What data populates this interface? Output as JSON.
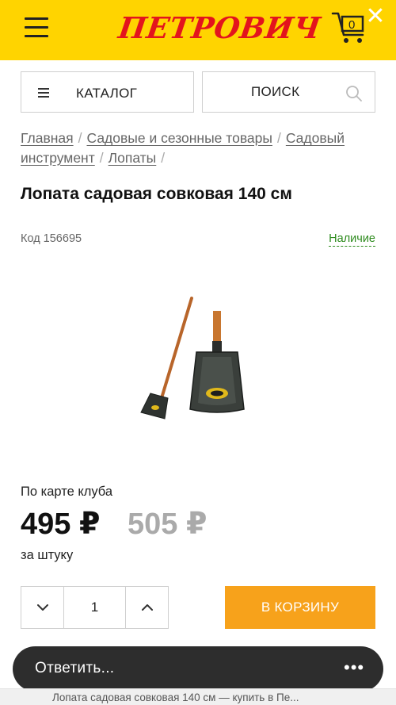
{
  "header": {
    "logo_text": "ПЕТРОВИЧ",
    "cart_count": "0",
    "brand_color": "#ffd400",
    "logo_color": "#e3141d"
  },
  "nav": {
    "catalog_label": "КАТАЛОГ",
    "search_label": "ПОИСК"
  },
  "breadcrumb": {
    "items": [
      "Главная",
      "Садовые и сезонные товары",
      "Садовый инструмент",
      "Лопаты"
    ],
    "separator": "/"
  },
  "product": {
    "title": "Лопата садовая совковая 140 см",
    "code": "Код 156695",
    "availability": "Наличие",
    "club_label": "По карте клуба",
    "price": "495 ₽",
    "old_price": "505 ₽",
    "unit": "за штуку",
    "quantity": "1",
    "add_to_cart_label": "В КОРЗИНУ",
    "accent_color": "#f7a21b",
    "stock_color": "#2e8b1e"
  },
  "reply_bar": {
    "label": "Ответить..."
  },
  "page_tab": {
    "title": "Лопата садовая совковая 140 см — купить в Пе..."
  }
}
